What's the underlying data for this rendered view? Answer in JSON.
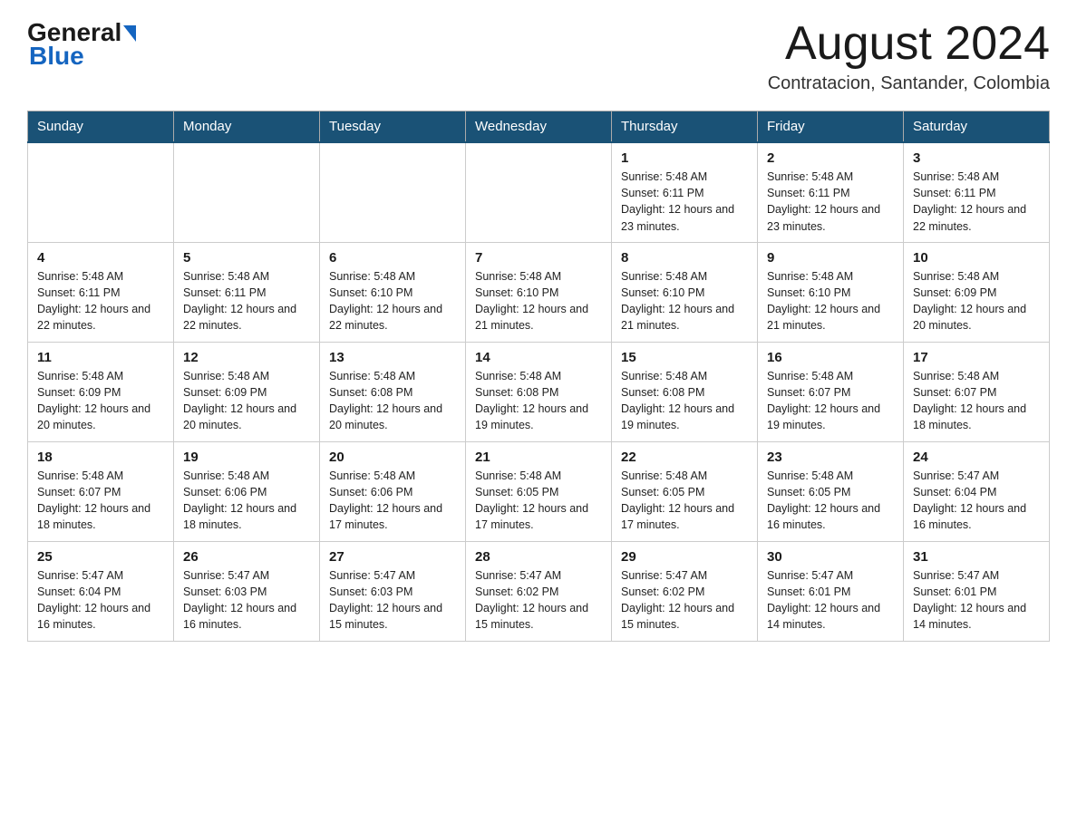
{
  "header": {
    "logo_general": "General",
    "logo_blue": "Blue",
    "month_title": "August 2024",
    "location": "Contratacion, Santander, Colombia"
  },
  "weekdays": [
    "Sunday",
    "Monday",
    "Tuesday",
    "Wednesday",
    "Thursday",
    "Friday",
    "Saturday"
  ],
  "weeks": [
    [
      {
        "day": "",
        "sunrise": "",
        "sunset": "",
        "daylight": ""
      },
      {
        "day": "",
        "sunrise": "",
        "sunset": "",
        "daylight": ""
      },
      {
        "day": "",
        "sunrise": "",
        "sunset": "",
        "daylight": ""
      },
      {
        "day": "",
        "sunrise": "",
        "sunset": "",
        "daylight": ""
      },
      {
        "day": "1",
        "sunrise": "Sunrise: 5:48 AM",
        "sunset": "Sunset: 6:11 PM",
        "daylight": "Daylight: 12 hours and 23 minutes."
      },
      {
        "day": "2",
        "sunrise": "Sunrise: 5:48 AM",
        "sunset": "Sunset: 6:11 PM",
        "daylight": "Daylight: 12 hours and 23 minutes."
      },
      {
        "day": "3",
        "sunrise": "Sunrise: 5:48 AM",
        "sunset": "Sunset: 6:11 PM",
        "daylight": "Daylight: 12 hours and 22 minutes."
      }
    ],
    [
      {
        "day": "4",
        "sunrise": "Sunrise: 5:48 AM",
        "sunset": "Sunset: 6:11 PM",
        "daylight": "Daylight: 12 hours and 22 minutes."
      },
      {
        "day": "5",
        "sunrise": "Sunrise: 5:48 AM",
        "sunset": "Sunset: 6:11 PM",
        "daylight": "Daylight: 12 hours and 22 minutes."
      },
      {
        "day": "6",
        "sunrise": "Sunrise: 5:48 AM",
        "sunset": "Sunset: 6:10 PM",
        "daylight": "Daylight: 12 hours and 22 minutes."
      },
      {
        "day": "7",
        "sunrise": "Sunrise: 5:48 AM",
        "sunset": "Sunset: 6:10 PM",
        "daylight": "Daylight: 12 hours and 21 minutes."
      },
      {
        "day": "8",
        "sunrise": "Sunrise: 5:48 AM",
        "sunset": "Sunset: 6:10 PM",
        "daylight": "Daylight: 12 hours and 21 minutes."
      },
      {
        "day": "9",
        "sunrise": "Sunrise: 5:48 AM",
        "sunset": "Sunset: 6:10 PM",
        "daylight": "Daylight: 12 hours and 21 minutes."
      },
      {
        "day": "10",
        "sunrise": "Sunrise: 5:48 AM",
        "sunset": "Sunset: 6:09 PM",
        "daylight": "Daylight: 12 hours and 20 minutes."
      }
    ],
    [
      {
        "day": "11",
        "sunrise": "Sunrise: 5:48 AM",
        "sunset": "Sunset: 6:09 PM",
        "daylight": "Daylight: 12 hours and 20 minutes."
      },
      {
        "day": "12",
        "sunrise": "Sunrise: 5:48 AM",
        "sunset": "Sunset: 6:09 PM",
        "daylight": "Daylight: 12 hours and 20 minutes."
      },
      {
        "day": "13",
        "sunrise": "Sunrise: 5:48 AM",
        "sunset": "Sunset: 6:08 PM",
        "daylight": "Daylight: 12 hours and 20 minutes."
      },
      {
        "day": "14",
        "sunrise": "Sunrise: 5:48 AM",
        "sunset": "Sunset: 6:08 PM",
        "daylight": "Daylight: 12 hours and 19 minutes."
      },
      {
        "day": "15",
        "sunrise": "Sunrise: 5:48 AM",
        "sunset": "Sunset: 6:08 PM",
        "daylight": "Daylight: 12 hours and 19 minutes."
      },
      {
        "day": "16",
        "sunrise": "Sunrise: 5:48 AM",
        "sunset": "Sunset: 6:07 PM",
        "daylight": "Daylight: 12 hours and 19 minutes."
      },
      {
        "day": "17",
        "sunrise": "Sunrise: 5:48 AM",
        "sunset": "Sunset: 6:07 PM",
        "daylight": "Daylight: 12 hours and 18 minutes."
      }
    ],
    [
      {
        "day": "18",
        "sunrise": "Sunrise: 5:48 AM",
        "sunset": "Sunset: 6:07 PM",
        "daylight": "Daylight: 12 hours and 18 minutes."
      },
      {
        "day": "19",
        "sunrise": "Sunrise: 5:48 AM",
        "sunset": "Sunset: 6:06 PM",
        "daylight": "Daylight: 12 hours and 18 minutes."
      },
      {
        "day": "20",
        "sunrise": "Sunrise: 5:48 AM",
        "sunset": "Sunset: 6:06 PM",
        "daylight": "Daylight: 12 hours and 17 minutes."
      },
      {
        "day": "21",
        "sunrise": "Sunrise: 5:48 AM",
        "sunset": "Sunset: 6:05 PM",
        "daylight": "Daylight: 12 hours and 17 minutes."
      },
      {
        "day": "22",
        "sunrise": "Sunrise: 5:48 AM",
        "sunset": "Sunset: 6:05 PM",
        "daylight": "Daylight: 12 hours and 17 minutes."
      },
      {
        "day": "23",
        "sunrise": "Sunrise: 5:48 AM",
        "sunset": "Sunset: 6:05 PM",
        "daylight": "Daylight: 12 hours and 16 minutes."
      },
      {
        "day": "24",
        "sunrise": "Sunrise: 5:47 AM",
        "sunset": "Sunset: 6:04 PM",
        "daylight": "Daylight: 12 hours and 16 minutes."
      }
    ],
    [
      {
        "day": "25",
        "sunrise": "Sunrise: 5:47 AM",
        "sunset": "Sunset: 6:04 PM",
        "daylight": "Daylight: 12 hours and 16 minutes."
      },
      {
        "day": "26",
        "sunrise": "Sunrise: 5:47 AM",
        "sunset": "Sunset: 6:03 PM",
        "daylight": "Daylight: 12 hours and 16 minutes."
      },
      {
        "day": "27",
        "sunrise": "Sunrise: 5:47 AM",
        "sunset": "Sunset: 6:03 PM",
        "daylight": "Daylight: 12 hours and 15 minutes."
      },
      {
        "day": "28",
        "sunrise": "Sunrise: 5:47 AM",
        "sunset": "Sunset: 6:02 PM",
        "daylight": "Daylight: 12 hours and 15 minutes."
      },
      {
        "day": "29",
        "sunrise": "Sunrise: 5:47 AM",
        "sunset": "Sunset: 6:02 PM",
        "daylight": "Daylight: 12 hours and 15 minutes."
      },
      {
        "day": "30",
        "sunrise": "Sunrise: 5:47 AM",
        "sunset": "Sunset: 6:01 PM",
        "daylight": "Daylight: 12 hours and 14 minutes."
      },
      {
        "day": "31",
        "sunrise": "Sunrise: 5:47 AM",
        "sunset": "Sunset: 6:01 PM",
        "daylight": "Daylight: 12 hours and 14 minutes."
      }
    ]
  ]
}
